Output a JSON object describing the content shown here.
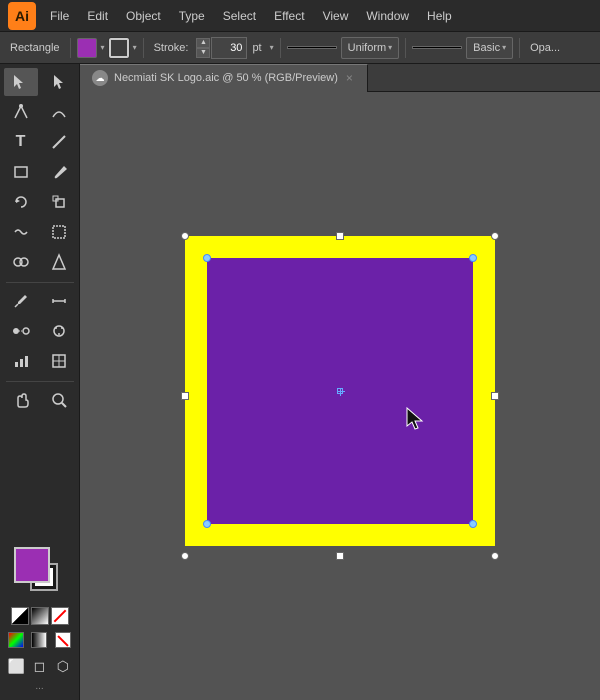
{
  "app": {
    "logo": "Ai",
    "logo_color": "#ff7f18"
  },
  "menu": {
    "items": [
      "File",
      "Edit",
      "Object",
      "Type",
      "Select",
      "Effect",
      "View",
      "Window",
      "Help"
    ]
  },
  "toolbar": {
    "shape_label": "Rectangle",
    "fill_color": "#9b2fb3",
    "stroke_indicator": "square",
    "stroke_label": "Stroke:",
    "stroke_value": "30",
    "stroke_unit": "pt",
    "line_style": "solid",
    "uniform_label": "Uniform",
    "basic_label": "Basic",
    "opacity_label": "Opa..."
  },
  "tab": {
    "icon": "☁",
    "title": "Necmiati SK Logo.aic @ 50 % (RGB/Preview)",
    "close": "×"
  },
  "canvas": {
    "outer_color": "#ffff00",
    "inner_color": "#7b22c4"
  },
  "toolbox": {
    "fill_color": "#9b2fb3",
    "stroke_color": "#ffffff",
    "tools": [
      {
        "icon": "▸",
        "name": "selection"
      },
      {
        "icon": "⬡",
        "name": "direct-selection"
      },
      {
        "icon": "✎",
        "name": "pen"
      },
      {
        "icon": "⟲",
        "name": "rotate"
      },
      {
        "icon": "T",
        "name": "type"
      },
      {
        "icon": "/",
        "name": "line"
      },
      {
        "icon": "⬜",
        "name": "rectangle"
      },
      {
        "icon": "✋",
        "name": "hand"
      },
      {
        "icon": "⬡",
        "name": "pencil"
      },
      {
        "icon": "⟳",
        "name": "blend"
      },
      {
        "icon": "◎",
        "name": "zoom"
      },
      {
        "icon": "⬡",
        "name": "eyedropper"
      }
    ],
    "more_label": "..."
  }
}
